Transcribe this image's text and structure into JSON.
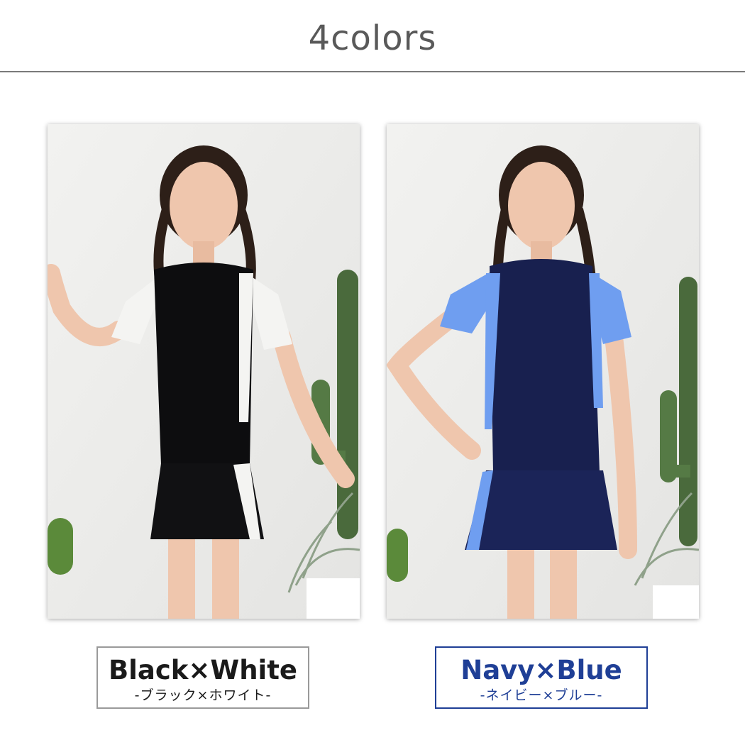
{
  "header": {
    "title": "4colors"
  },
  "colors": {
    "rule": "#7a7a7a",
    "navy_label": "#1f3f96",
    "black_label": "#1a1a1a"
  },
  "variants": [
    {
      "name": "Black×White",
      "name_jp": "-ブラック×ホワイト-",
      "top_color": "#0d0d0f",
      "accent_color": "#f4f4f2"
    },
    {
      "name": "Navy×Blue",
      "name_jp": "-ネイビー×ブルー-",
      "top_color": "#18204f",
      "accent_color": "#6f9ef0"
    }
  ]
}
